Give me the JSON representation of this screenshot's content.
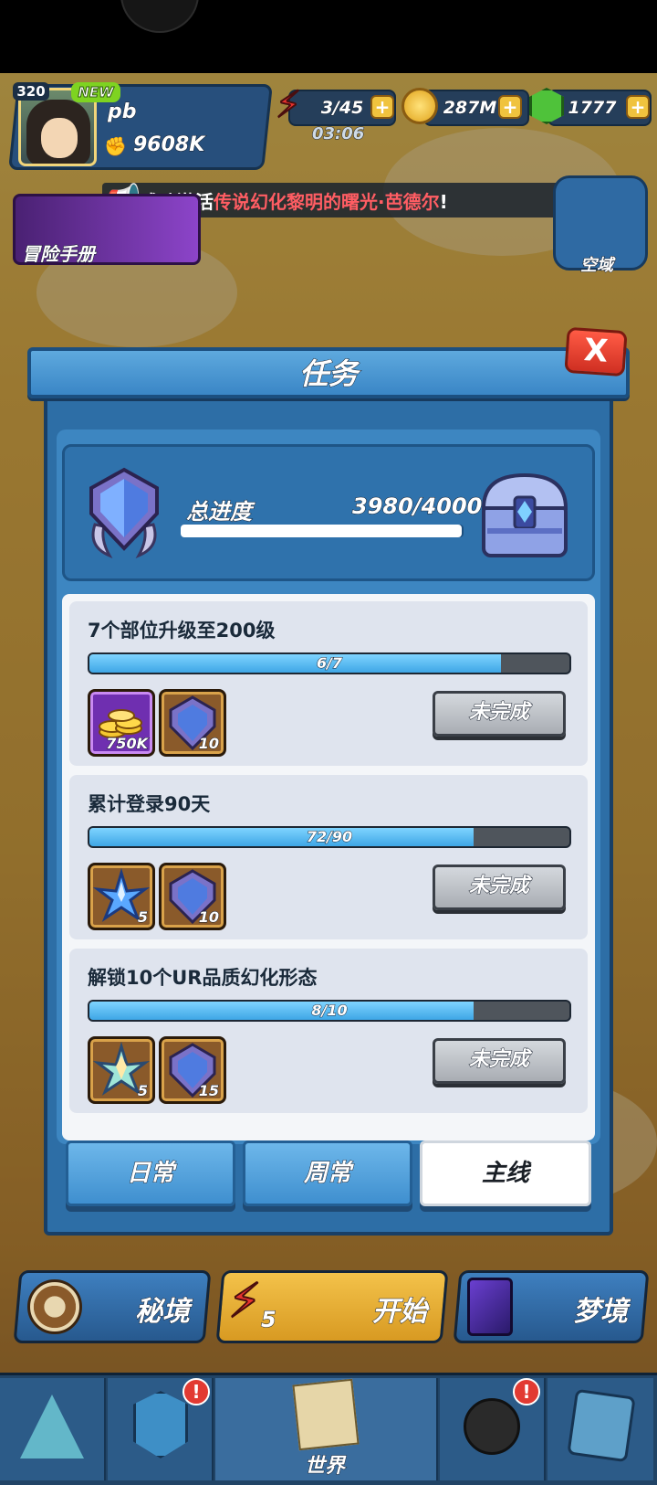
{
  "hud": {
    "level": "320",
    "new_badge": "NEW",
    "player_name": "pb",
    "power": "9608K",
    "energy": "3/45",
    "energy_timer": "03:06",
    "coins": "287M",
    "gems": "1777",
    "plus": "+"
  },
  "announcement": {
    "prefix": "成功激活",
    "highlight": "传说幻化黎明的曙光·芭德尔",
    "suffix": "!"
  },
  "side": {
    "adventure_manual": "冒险手册",
    "airspace": "空域"
  },
  "modal": {
    "title": "任务",
    "close": "X",
    "total_label": "总进度",
    "total_value": "3980/4000",
    "total_progress": 0.995
  },
  "tasks": [
    {
      "title": "7个部位升级至200级",
      "progress_text": "6/7",
      "progress": 0.857,
      "rewards": [
        {
          "icon": "gold-coins-icon",
          "qty": "750K",
          "rarity": "purple"
        },
        {
          "icon": "blue-crest-icon",
          "qty": "10",
          "rarity": "gold"
        }
      ],
      "button": "未完成"
    },
    {
      "title": "累计登录90天",
      "progress_text": "72/90",
      "progress": 0.8,
      "rewards": [
        {
          "icon": "blue-star-icon",
          "qty": "5",
          "rarity": "gold"
        },
        {
          "icon": "blue-crest-icon",
          "qty": "10",
          "rarity": "gold"
        }
      ],
      "button": "未完成"
    },
    {
      "title": "解锁10个UR品质幻化形态",
      "progress_text": "8/10",
      "progress": 0.8,
      "rewards": [
        {
          "icon": "rainbow-star-icon",
          "qty": "5",
          "rarity": "gold"
        },
        {
          "icon": "blue-crest-icon",
          "qty": "15",
          "rarity": "gold"
        }
      ],
      "button": "未完成"
    }
  ],
  "tabs": [
    {
      "label": "日常",
      "active": false
    },
    {
      "label": "周常",
      "active": false
    },
    {
      "label": "主线",
      "active": true
    }
  ],
  "modes": {
    "secret": "秘境",
    "start": "开始",
    "start_cost": "5",
    "dream": "梦境"
  },
  "nav": {
    "world": "世界",
    "alert": "!"
  },
  "colors": {
    "panel_blue": "#2d6ea6",
    "progress_fill": "#3ea6e6",
    "highlight_red": "#ff5d63",
    "close_red": "#cf2f22"
  }
}
